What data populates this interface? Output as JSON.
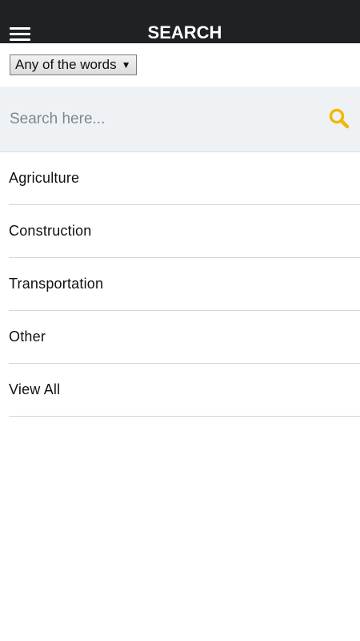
{
  "header": {
    "title": "SEARCH",
    "background_color": "#1f2225",
    "menu_icon": "hamburger-menu-icon"
  },
  "search_mode": {
    "selected": "Any of the words",
    "arrow": "▼"
  },
  "search": {
    "placeholder": "Search here...",
    "value": "",
    "icon": "search-icon",
    "icon_color": "#f2b705",
    "background_color": "#eff2f5"
  },
  "categories": {
    "items": [
      {
        "label": "Agriculture"
      },
      {
        "label": "Construction"
      },
      {
        "label": "Transportation"
      },
      {
        "label": "Other"
      },
      {
        "label": "View All"
      }
    ]
  }
}
